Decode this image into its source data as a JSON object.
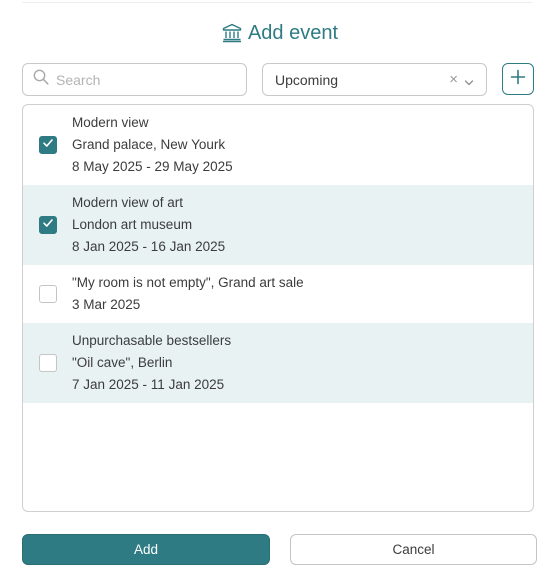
{
  "dialog": {
    "title": "Add event",
    "title_icon": "museum-icon"
  },
  "search": {
    "placeholder": "Search",
    "value": ""
  },
  "filter": {
    "selected": "Upcoming",
    "clear_glyph": "×"
  },
  "events": [
    {
      "name": "Modern view",
      "location": "Grand palace, New Yourk",
      "dates": "8 May 2025 - 29 May 2025",
      "checked": true
    },
    {
      "name": "Modern view of art",
      "location": "London art museum",
      "dates": "8 Jan 2025 - 16 Jan 2025",
      "checked": true
    },
    {
      "name": "\"My room is not empty\", Grand art sale",
      "dates": "3 Mar 2025",
      "checked": false
    },
    {
      "name": "Unpurchasable bestsellers",
      "location": "\"Oil cave\", Berlin",
      "dates": "7 Jan 2025 - 11 Jan 2025",
      "checked": false
    }
  ],
  "actions": {
    "add_label": "Add",
    "cancel_label": "Cancel"
  },
  "colors": {
    "accent": "#2e7b83",
    "row_highlight": "#e8f2f3"
  }
}
